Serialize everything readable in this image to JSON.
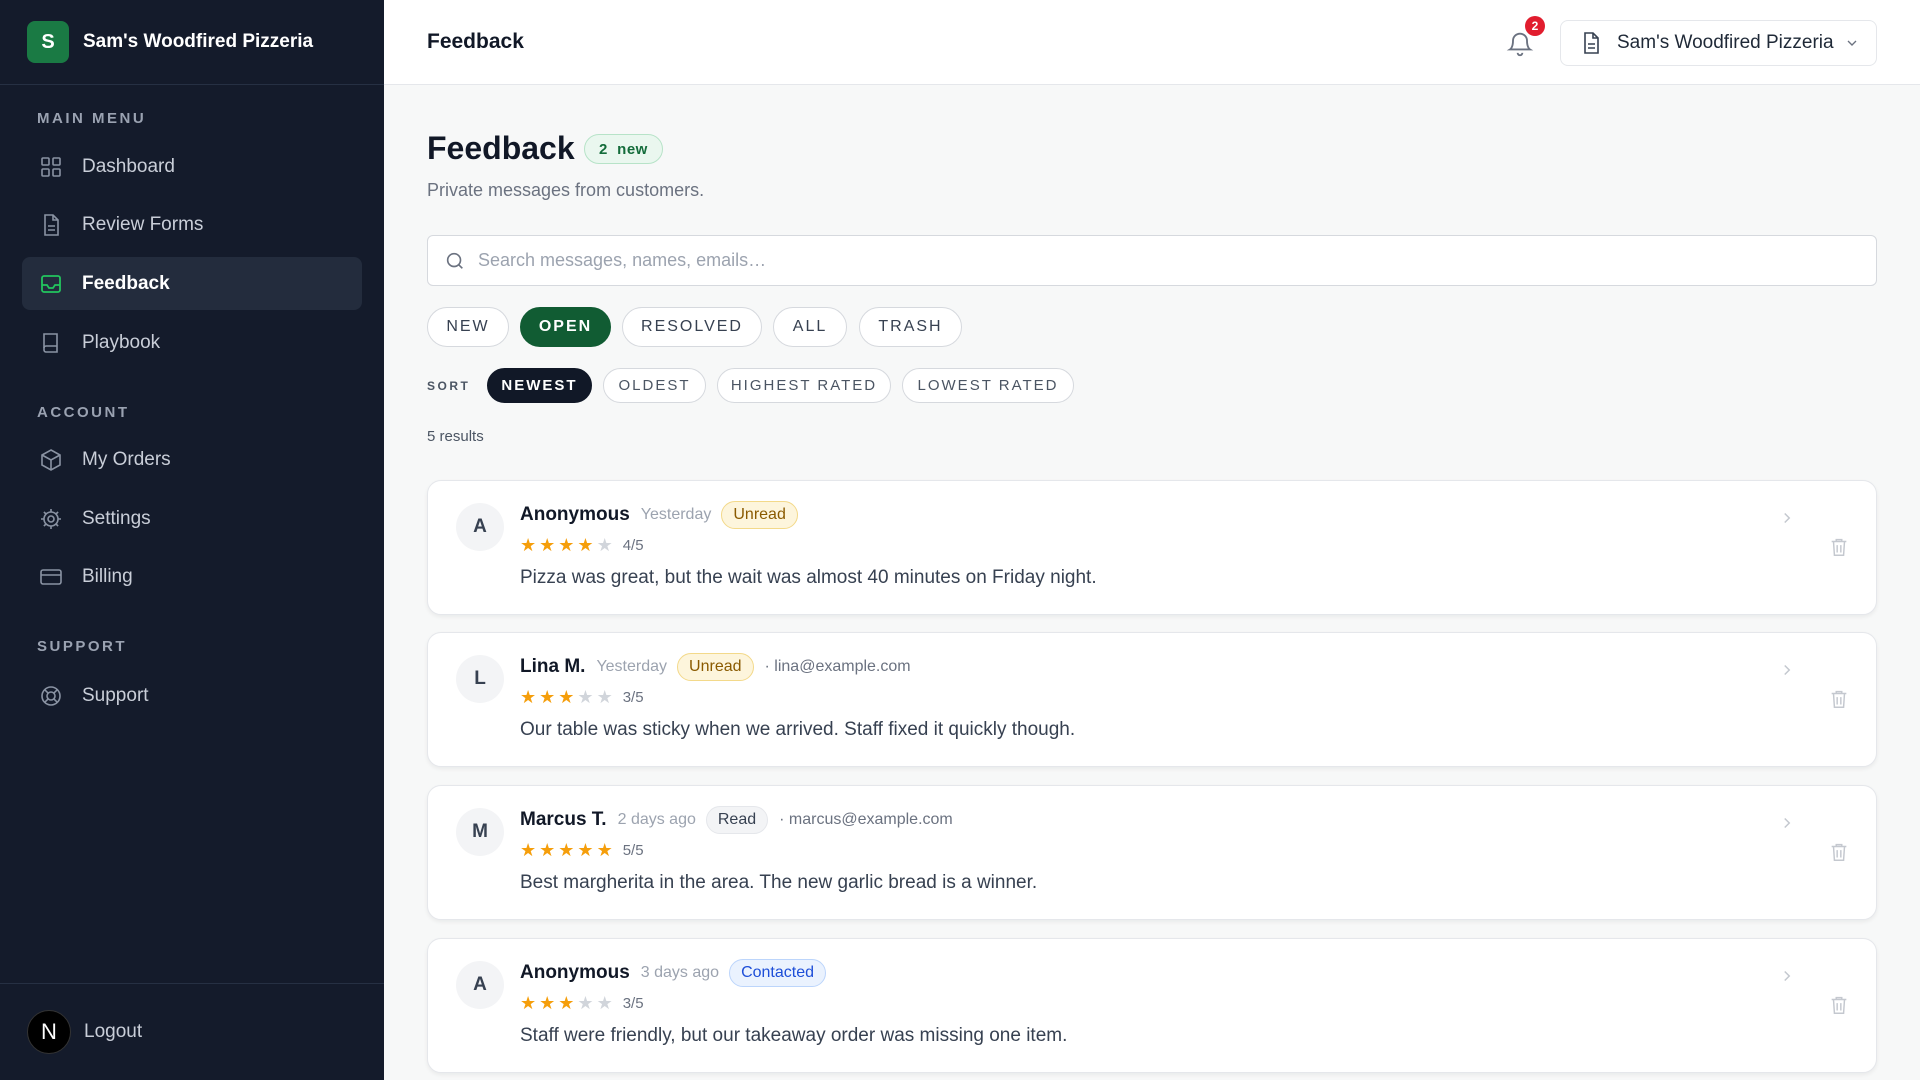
{
  "sidebar": {
    "logo_letter": "S",
    "business_name": "Sam's Woodfired Pizzeria",
    "sections": {
      "main": "MAIN MENU",
      "account": "ACCOUNT",
      "support": "SUPPORT"
    },
    "items": [
      {
        "label": "Dashboard",
        "icon": "grid-icon"
      },
      {
        "label": "Review Forms",
        "icon": "document-icon"
      },
      {
        "label": "Feedback",
        "icon": "inbox-icon",
        "active": true
      },
      {
        "label": "Playbook",
        "icon": "book-icon"
      },
      {
        "label": "My Orders",
        "icon": "box-icon"
      },
      {
        "label": "Settings",
        "icon": "gear-icon"
      },
      {
        "label": "Billing",
        "icon": "credit-card-icon"
      },
      {
        "label": "Support",
        "icon": "lifebuoy-icon"
      }
    ],
    "logout": {
      "avatar_letter": "N",
      "label": "Logout"
    }
  },
  "header": {
    "title": "Feedback",
    "notification_count": "2",
    "business_selector": "Sam's Woodfired Pizzeria"
  },
  "main": {
    "title": "Feedback",
    "new_pill": "2  new",
    "subtitle": "Private messages from customers.",
    "search_placeholder": "Search messages, names, emails…",
    "filters": [
      "NEW",
      "OPEN",
      "RESOLVED",
      "ALL",
      "TRASH"
    ],
    "active_filter": "OPEN",
    "sort_label": "SORT",
    "sorts": [
      "NEWEST",
      "OLDEST",
      "HIGHEST RATED",
      "LOWEST RATED"
    ],
    "active_sort": "NEWEST",
    "results": "5 results"
  },
  "feedback": [
    {
      "initial": "A",
      "name": "Anonymous",
      "time": "Yesterday",
      "status": "Unread",
      "email": "",
      "rating": 4,
      "rating_text": "4/5",
      "message": "Pizza was great, but the wait was almost 40 minutes on Friday night."
    },
    {
      "initial": "L",
      "name": "Lina M.",
      "time": "Yesterday",
      "status": "Unread",
      "email": "· lina@example.com",
      "rating": 3,
      "rating_text": "3/5",
      "message": "Our table was sticky when we arrived. Staff fixed it quickly though."
    },
    {
      "initial": "M",
      "name": "Marcus T.",
      "time": "2 days ago",
      "status": "Read",
      "email": "· marcus@example.com",
      "rating": 5,
      "rating_text": "5/5",
      "message": "Best margherita in the area. The new garlic bread is a winner."
    },
    {
      "initial": "A",
      "name": "Anonymous",
      "time": "3 days ago",
      "status": "Contacted",
      "email": "",
      "rating": 3,
      "rating_text": "3/5",
      "message": "Staff were friendly, but our takeaway order was missing one item."
    }
  ],
  "colors": {
    "sidebar_bg": "#141b2b",
    "brand_green": "#1a7a44",
    "active_filter": "#115c33",
    "star_filled": "#f59e0b",
    "star_empty": "#d1d5db",
    "badge_unread": "#fdf5dc",
    "badge_read": "#f3f4f6",
    "badge_contacted": "#eaf2fe",
    "notification_red": "#e11d2e"
  }
}
